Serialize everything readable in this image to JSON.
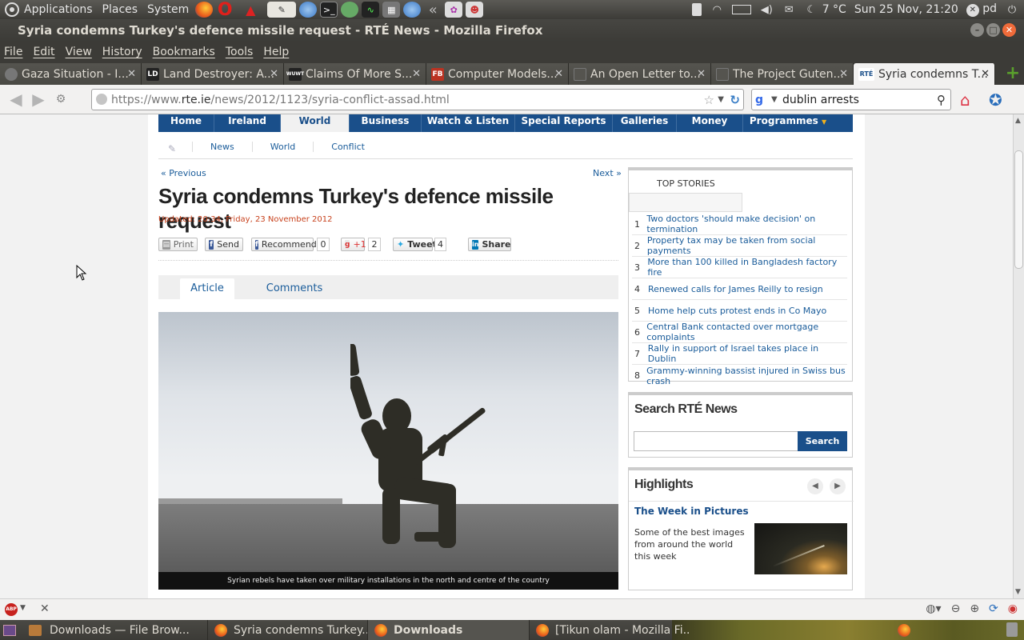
{
  "top_panel": {
    "menus": [
      "Applications",
      "Places",
      "System"
    ],
    "weather": "7 °C",
    "clock": "Sun 25 Nov, 21:20",
    "user": "pd"
  },
  "window": {
    "title": "Syria condemns Turkey's defence missile request - RTÉ News - Mozilla Firefox"
  },
  "menubar": [
    "File",
    "Edit",
    "View",
    "History",
    "Bookmarks",
    "Tools",
    "Help"
  ],
  "tabs": [
    {
      "label": "Gaza Situation - I...",
      "fav": ""
    },
    {
      "label": "Land Destroyer: A...",
      "fav": "LD"
    },
    {
      "label": "Claims Of More S...",
      "fav": "WUWT"
    },
    {
      "label": "Computer Models...",
      "fav": "FB"
    },
    {
      "label": "An Open Letter to...",
      "fav": ""
    },
    {
      "label": "The Project Guten...",
      "fav": ""
    },
    {
      "label": "Syria condemns T...",
      "fav": "RTÉ"
    }
  ],
  "navbar": {
    "url_scheme": "https://www.",
    "url_domain": "rte.ie",
    "url_path": "/news/2012/1123/syria-conflict-assad.html",
    "search_value": "dublin arrests"
  },
  "page": {
    "primary_nav": [
      "Home",
      "Ireland",
      "World",
      "Business",
      "Watch & Listen",
      "Special Reports",
      "Galleries",
      "Money",
      "Programmes"
    ],
    "sub_nav": [
      "News",
      "World",
      "Conflict"
    ],
    "prev_label": "« Previous",
    "next_label": "Next »",
    "headline": "Syria condemns Turkey's defence missile request",
    "updated": "Updated: 20:34, Friday, 23 November 2012",
    "share": {
      "print": "Print",
      "send": "Send",
      "recommend": "Recommend",
      "recommend_count": "0",
      "plus_one": "+1",
      "plus_one_count": "2",
      "tweet": "Tweet",
      "tweet_count": "4",
      "share": "Share"
    },
    "article_tabs": [
      "Article",
      "Comments"
    ],
    "caption": "Syrian rebels have taken over military installations in the north and centre of the country",
    "top_stories": {
      "title": "TOP STORIES",
      "items": [
        {
          "num": "1",
          "title": "Two doctors 'should make decision' on termination"
        },
        {
          "num": "2",
          "title": "Property tax may be taken from social payments"
        },
        {
          "num": "3",
          "title": "More than 100 killed in Bangladesh factory fire"
        },
        {
          "num": "4",
          "title": "Renewed calls for James Reilly to resign"
        },
        {
          "num": "5",
          "title": "Home help cuts protest ends in Co Mayo"
        },
        {
          "num": "6",
          "title": "Central Bank contacted over mortgage complaints"
        },
        {
          "num": "7",
          "title": "Rally in support of Israel takes place in Dublin"
        },
        {
          "num": "8",
          "title": "Grammy-winning bassist injured in Swiss bus crash"
        }
      ]
    },
    "search_news": {
      "title": "Search RTÉ News",
      "button": "Search"
    },
    "highlights": {
      "title": "Highlights",
      "item_title": "The Week in Pictures",
      "item_desc": "Some of the best images from around the world this week"
    }
  },
  "taskbar": [
    {
      "label": "Downloads — File Brow...",
      "icon": "folder-icon"
    },
    {
      "label": "Syria condemns Turkey...",
      "icon": "firefox-icon"
    },
    {
      "label": "Downloads",
      "icon": "firefox-icon"
    },
    {
      "label": "[Tikun olam - Mozilla Fi...",
      "icon": "firefox-icon"
    }
  ],
  "colors": {
    "rte_blue": "#1a4f8a",
    "link_blue": "#1a5c9a",
    "updated_orange": "#c8421d",
    "ubuntu_panel": "#3c3b37"
  }
}
